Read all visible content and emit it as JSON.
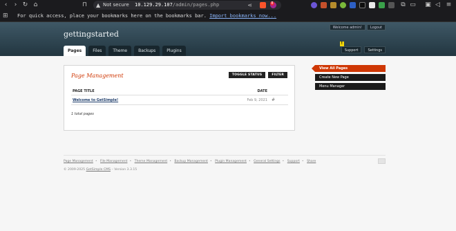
{
  "browser": {
    "url_warning": "Not secure",
    "url_host": "10.129.29.107",
    "url_path": "/admin/pages.php",
    "reward_badge": "8",
    "bookmarks_message": "For quick access, place your bookmarks here on the bookmarks bar.",
    "bookmarks_link": "Import bookmarks now..."
  },
  "header": {
    "site_name": "gettingstarted",
    "user_links": [
      "Welcome admin!",
      "Logout"
    ],
    "tabs": [
      "Pages",
      "Files",
      "Theme",
      "Backups",
      "Plugins"
    ],
    "right_tabs": [
      "Support",
      "Settings"
    ],
    "warning_glyph": "!"
  },
  "main": {
    "title": "Page Management",
    "buttons": [
      "TOGGLE STATUS",
      "FILTER"
    ],
    "columns": [
      "PAGE TITLE",
      "DATE"
    ],
    "rows": [
      {
        "title": "Welcome to GetSimple!",
        "date": "Feb 9, 2021"
      }
    ],
    "total": "1 total pages"
  },
  "sidebar": {
    "items": [
      "View All Pages",
      "Create New Page",
      "Menu Manager"
    ]
  },
  "footer": {
    "links": [
      "Page Management",
      "File Management",
      "Theme Management",
      "Backup Management",
      "Plugin Management",
      "General Settings",
      "Support",
      "Share"
    ],
    "copyright_prefix": "© 2009-2025",
    "copyright_link": "GetSimple CMS",
    "copyright_suffix": "– Version 3.3.15"
  },
  "colors": {
    "accent": "#cf3805",
    "header_top": "#3f5866",
    "header_bottom": "#223640"
  }
}
